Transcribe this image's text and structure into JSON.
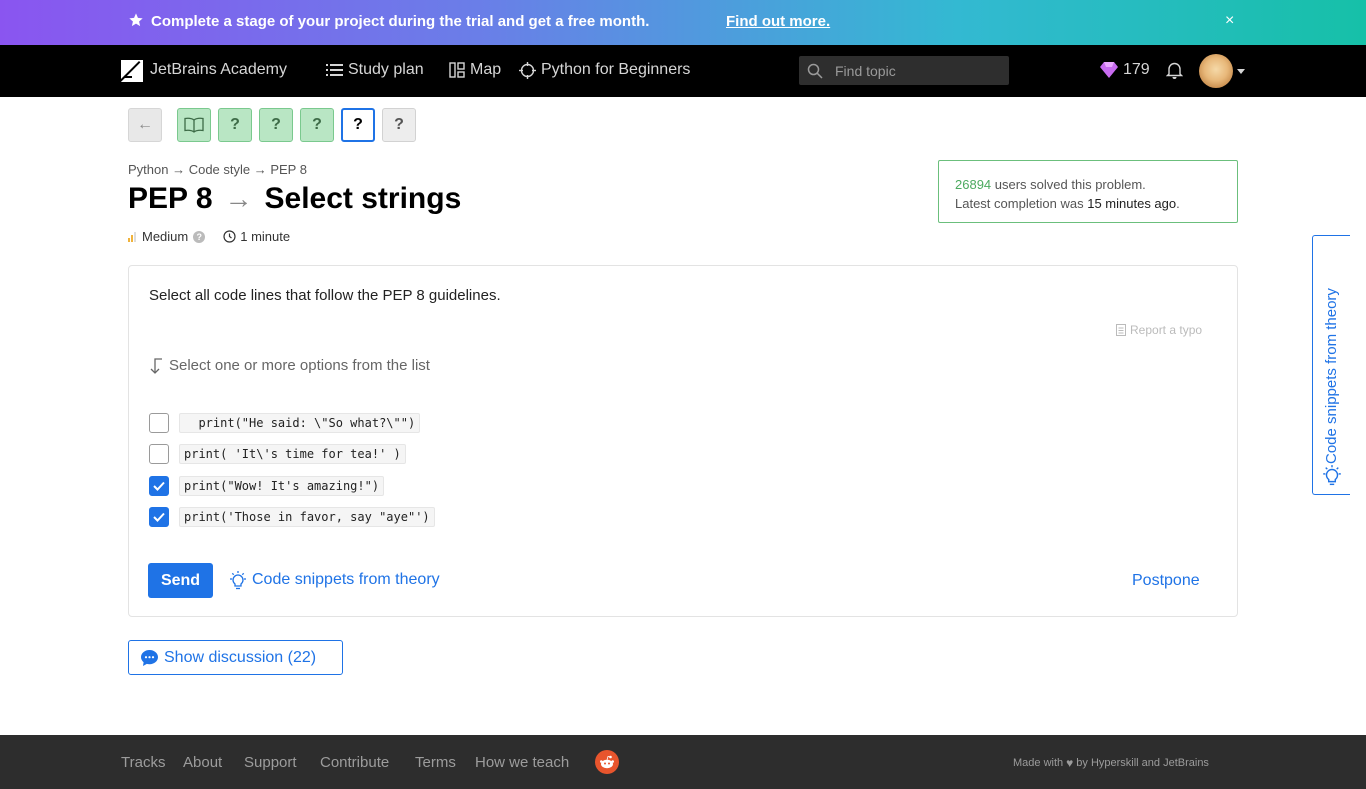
{
  "banner": {
    "text": "Complete a stage of your project during the trial and get a free month.",
    "link": "Find out more.",
    "close": "×",
    "icon": "star-icon"
  },
  "header": {
    "logo_text": "JetBrains Academy",
    "nav": [
      {
        "label": "Study plan",
        "icon": "list-icon"
      },
      {
        "label": "Map",
        "icon": "map-icon"
      },
      {
        "label": "Python for Beginners",
        "icon": "target-icon"
      }
    ],
    "search_placeholder": "Find topic",
    "gems": "179"
  },
  "steps": [
    {
      "label": "←",
      "state": "back"
    },
    {
      "label": "",
      "state": "done",
      "icon": "book-icon"
    },
    {
      "label": "?",
      "state": "done"
    },
    {
      "label": "?",
      "state": "done"
    },
    {
      "label": "?",
      "state": "done"
    },
    {
      "label": "?",
      "state": "current"
    },
    {
      "label": "?",
      "state": "todo"
    }
  ],
  "breadcrumb": "Python → Code style → PEP 8",
  "title": {
    "topic": "PEP 8",
    "arrow": "→",
    "name": "Select strings"
  },
  "meta": {
    "difficulty": "Medium",
    "help": "?",
    "time": "1 minute"
  },
  "solved": {
    "count": "26894",
    "line1_rest": " users solved this problem.",
    "line2_prefix": "Latest completion was ",
    "line2_time": "15 minutes ago",
    "line2_suffix": "."
  },
  "task": {
    "text": "Select all code lines that follow the PEP 8 guidelines.",
    "report_typo": "Report a typo",
    "hint": "Select one or more options from the list",
    "options": [
      {
        "code": "  print(\"He said: \\\"So what?\\\"\")",
        "checked": false
      },
      {
        "code": "print( 'It\\'s time for tea!' )",
        "checked": false
      },
      {
        "code": "print(\"Wow! It's amazing!\")",
        "checked": true
      },
      {
        "code": "print('Those in favor, say \"aye\"')",
        "checked": true
      }
    ],
    "send": "Send",
    "snippets": "Code snippets from theory",
    "postpone": "Postpone"
  },
  "discussion": "Show discussion (22)",
  "side_tab": "Code snippets from theory",
  "footer": {
    "links": [
      "Tracks",
      "About",
      "Support",
      "Contribute",
      "Terms",
      "How we teach"
    ],
    "made_prefix": "Made with",
    "made_suffix": "by Hyperskill and JetBrains"
  },
  "colors": {
    "accent": "#1f73e6",
    "success": "#4caa5f",
    "done_step": "#b9e6c4"
  }
}
